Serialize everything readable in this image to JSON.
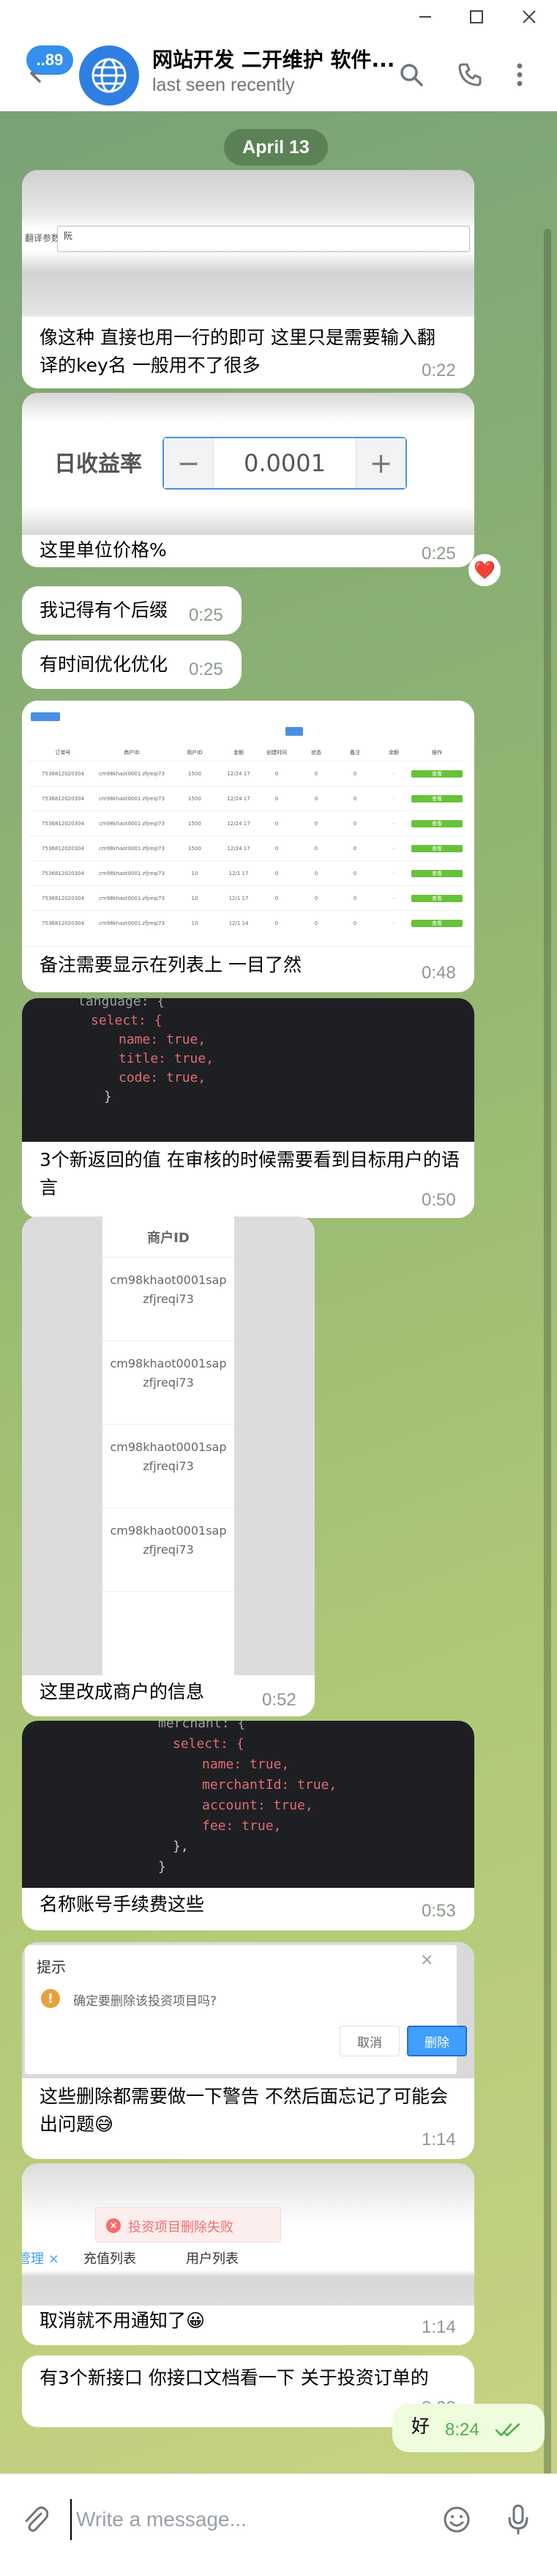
{
  "titlebar": {
    "minimize": "—",
    "maximize": "□",
    "close": "✕"
  },
  "header": {
    "unread_count": "..89",
    "title": "网站开发 二开维护 软件...",
    "status": "last seen recently",
    "icons": [
      "arrow-left-icon",
      "globe-icon",
      "search-icon",
      "phone-icon",
      "more-vertical-icon"
    ]
  },
  "date_label": "April 13",
  "messages": [
    {
      "text": "像这种 直接也用一行的即可 这里只是需要输入翻译的key名 一般用不了很多",
      "time": "0:22",
      "image": {
        "field_label": "翻译参数",
        "field_value": "阮"
      }
    },
    {
      "text": "这里单位价格%",
      "time": "0:25",
      "reaction": "❤️",
      "image": {
        "label": "日收益率",
        "minus": "−",
        "value": "0.0001",
        "plus": "+"
      }
    },
    {
      "text": "我记得有个后缀",
      "time": "0:25"
    },
    {
      "text": "有时间优化优化",
      "time": "0:25"
    },
    {
      "text": "备注需要显示在列表上 一目了然",
      "time": "0:48",
      "image": {
        "header_cells": [
          "订单号",
          "商户ID",
          "用户ID",
          "金额",
          "创建时间",
          "状态",
          "备注",
          "余额",
          "操作"
        ],
        "rows": [
          [
            "7536812020304",
            "cm98khaot0001",
            "zfjreqi73",
            "1500",
            "12/24 17",
            "0",
            "0",
            "0",
            "-",
            "查看"
          ],
          [
            "7536812020304",
            "cm98khaot0001",
            "zfjreqi73",
            "1500",
            "12/24 17",
            "0",
            "0",
            "0",
            "-",
            "查看"
          ],
          [
            "7536812020304",
            "cm98khaot0001",
            "zfjreqi73",
            "1500",
            "12/24 17",
            "0",
            "0",
            "0",
            "-",
            "查看"
          ],
          [
            "7536812020304",
            "cm98khaot0001",
            "zfjreqi73",
            "1500",
            "12/24 17",
            "0",
            "0",
            "0",
            "-",
            "查看"
          ],
          [
            "7536812020304",
            "cm98khaot0001",
            "zfjreqi73",
            "10",
            "12/1 17",
            "0",
            "0",
            "0",
            "-",
            "查看"
          ],
          [
            "7536812020304",
            "cm98khaot0001",
            "zfjreqi73",
            "10",
            "12/1 17",
            "0",
            "0",
            "0",
            "-",
            "查看"
          ],
          [
            "7536812020304",
            "cm98khaot0001",
            "zfjreqi73",
            "10",
            "12/1 14",
            "0",
            "0",
            "0",
            "-",
            "查看"
          ]
        ]
      }
    },
    {
      "text": "3个新返回的值 在审核的时候需要看到目标用户的语言",
      "time": "0:50",
      "image": {
        "code_lines": [
          "language: {",
          "select: {",
          "name: true,",
          "title: true,",
          "code: true,",
          "}"
        ]
      }
    },
    {
      "text": "这里改成商户的信息",
      "time": "0:52",
      "image": {
        "header": "商户ID",
        "cells": [
          "cm98khaot0001sapzfjreqi73",
          "cm98khaot0001sapzfjreqi73",
          "cm98khaot0001sapzfjreqi73",
          "cm98khaot0001sapzfjreqi73"
        ]
      }
    },
    {
      "text": "名称账号手续费这些",
      "time": "0:53",
      "image": {
        "code_lines": [
          "merchant: {",
          "select: {",
          "name: true,",
          "merchantId: true,",
          "account: true,",
          "fee: true,",
          "},",
          "}"
        ]
      }
    },
    {
      "text": "这些删除都需要做一下警告 不然后面忘记了可能会出问题😅",
      "time": "1:14",
      "image": {
        "dialog_title": "提示",
        "dialog_message": "确定要删除该投资项目吗?",
        "cancel": "取消",
        "delete": "删除",
        "close": "×"
      }
    },
    {
      "text": "取消就不用通知了😀",
      "time": "1:14",
      "image": {
        "toast": "投资项目删除失败",
        "tabs": [
          "管理 ×",
          "充值列表",
          "用户列表"
        ]
      }
    },
    {
      "text": "有3个新接口 你接口文档看一下 关于投资订单的",
      "time": "8:08"
    },
    {
      "text": "好",
      "time": "8:24",
      "outgoing": true
    }
  ],
  "composer": {
    "placeholder": "Write a message..."
  },
  "colors": {
    "accent": "#3390ec",
    "outgoing_bubble": "#effdde",
    "check": "#4fae4e",
    "chat_bg": "#9fbf76"
  }
}
